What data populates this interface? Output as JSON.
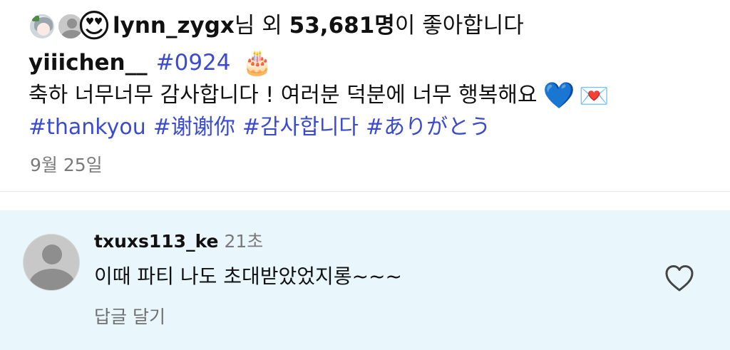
{
  "post": {
    "likes": {
      "first_liker": "lynn_zygx",
      "suffix_nim_oe": "님 외 ",
      "count": "53,681명",
      "suffix_end": "이 좋아합니다",
      "emoji": "😍"
    },
    "caption": {
      "username": "yiiichen__",
      "hashtag_first": "#0924",
      "cake_emoji": "🎂",
      "text": "축하 너무너무 감사합니다 ! 여러분 덕분에 너무 행복해요",
      "heart_emoji": "💙",
      "envelope_emoji": "💌",
      "hashtags": [
        "#thankyou",
        "#谢谢你",
        "#감사합니다",
        "#ありがとう"
      ]
    },
    "date": "9월 25일"
  },
  "comment": {
    "username": "txuxs113_ke",
    "time": "21초",
    "text": "이때 파티 나도 초대받았었지롱~~~",
    "reply_label": "답글 달기"
  },
  "colors": {
    "hashtag": "#3a4bd0",
    "comment_bg": "#e9f7fd",
    "muted_text": "#7a7a7a"
  },
  "icons": {
    "like": "heart-outline-icon",
    "avatar_placeholder": "default-avatar-icon"
  }
}
